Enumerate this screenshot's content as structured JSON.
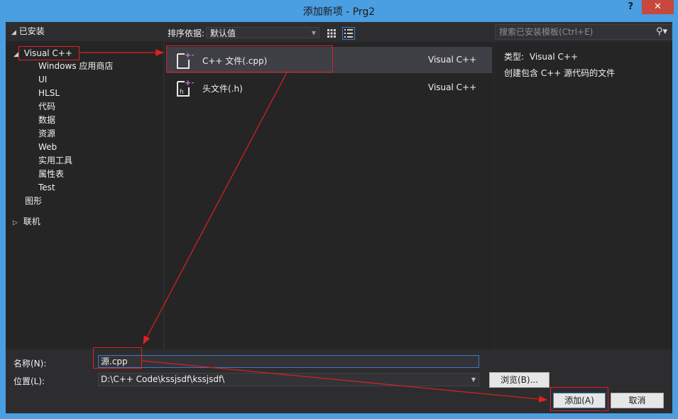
{
  "window": {
    "title": "添加新项 - Prg2",
    "help_label": "?",
    "close_label": "✕"
  },
  "tree": {
    "installed_label": "已安装",
    "visual_cpp_label": "Visual C++",
    "children": [
      "Windows 应用商店",
      "UI",
      "HLSL",
      "代码",
      "数据",
      "资源",
      "Web",
      "实用工具",
      "属性表",
      "Test"
    ],
    "graphics_label": "图形",
    "online_label": "联机"
  },
  "sortbar": {
    "label": "排序依据:",
    "value": "默认值"
  },
  "templates": [
    {
      "name": "C++ 文件(.cpp)",
      "language": "Visual C++",
      "icon": "cpp-file-icon"
    },
    {
      "name": "头文件(.h)",
      "language": "Visual C++",
      "icon": "header-file-icon"
    }
  ],
  "search": {
    "placeholder": "搜索已安装模板(Ctrl+E)"
  },
  "details": {
    "type_label": "类型:",
    "type_value": "Visual C++",
    "description": "创建包含 C++ 源代码的文件"
  },
  "form": {
    "name_label": "名称(N):",
    "name_value": "源.cpp",
    "location_label": "位置(L):",
    "location_value": "D:\\C++ Code\\kssjsdf\\kssjsdf\\",
    "browse_label": "浏览(B)...",
    "add_label": "添加(A)",
    "cancel_label": "取消"
  },
  "colors": {
    "annotation": "#e02020",
    "frame": "#4a9ee2",
    "background": "#2d2d30"
  }
}
